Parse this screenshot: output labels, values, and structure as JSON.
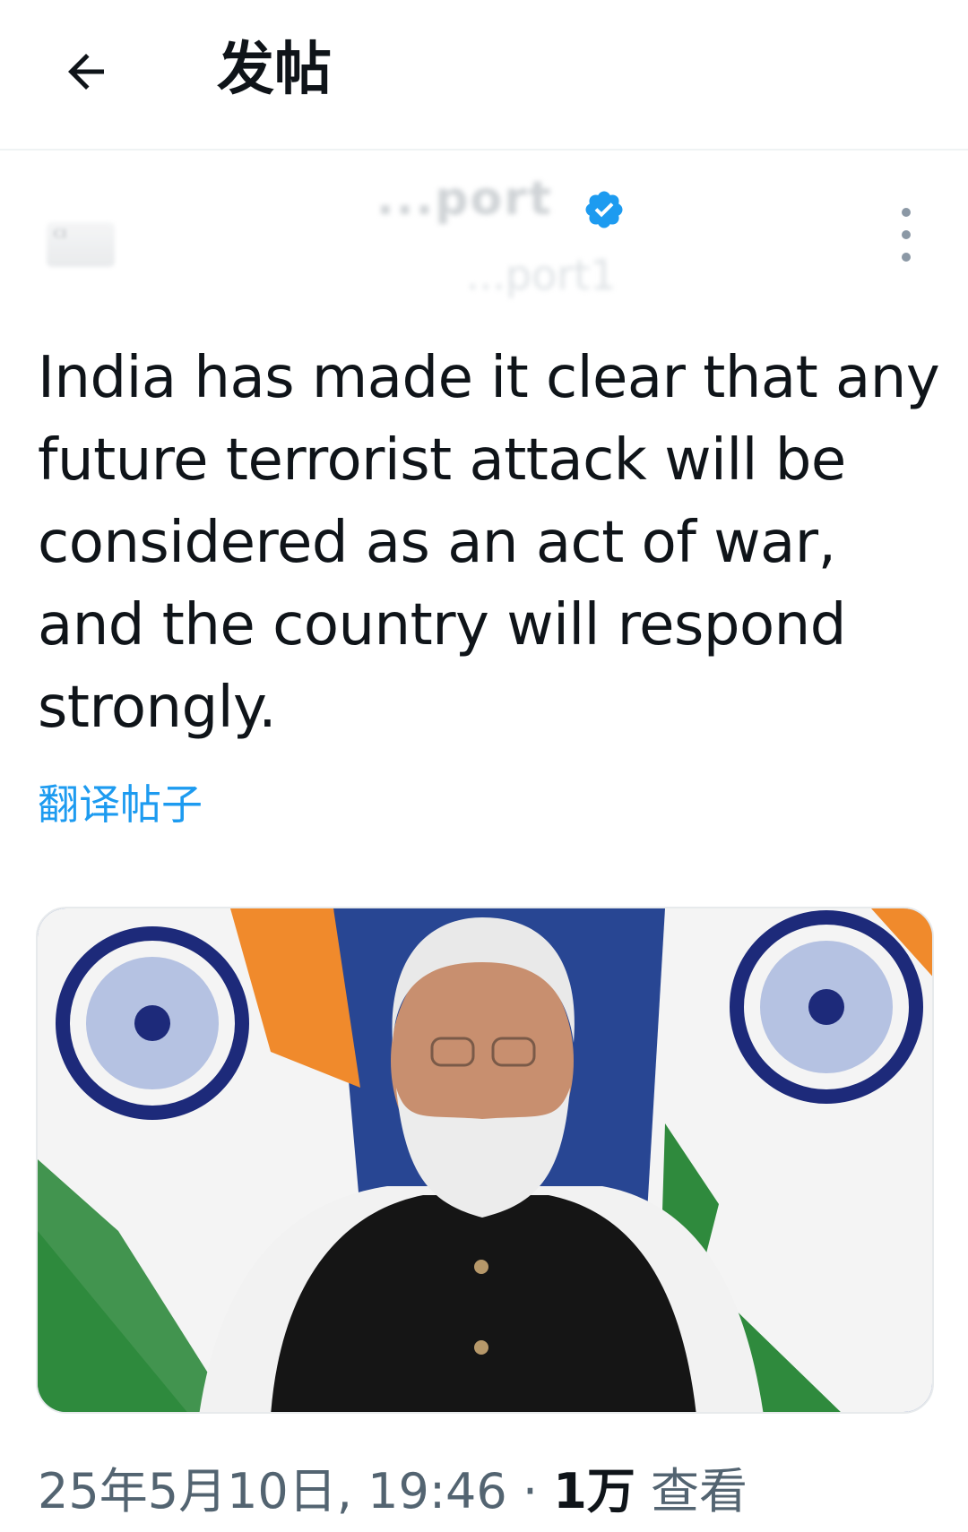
{
  "header": {
    "title": "发帖",
    "back_icon": "arrow-left-icon"
  },
  "author": {
    "display_name": "...port",
    "handle": "...port1",
    "avatar_text": "CI",
    "verified": true,
    "verified_color": "#1d9bf0"
  },
  "post": {
    "text": "India has made it clear that any future terrorist attack will be considered as an act of war, and the country will respond strongly.",
    "translate_label": "翻译帖子",
    "media_icon": "portrait-photo-indian-flags"
  },
  "meta": {
    "timestamp": "25年5月10日, 19:46",
    "separator": "·",
    "views_count": "1万",
    "views_label": "查看"
  },
  "colors": {
    "accent": "#1d9bf0",
    "text": "#0f1419",
    "secondary": "#536471"
  }
}
